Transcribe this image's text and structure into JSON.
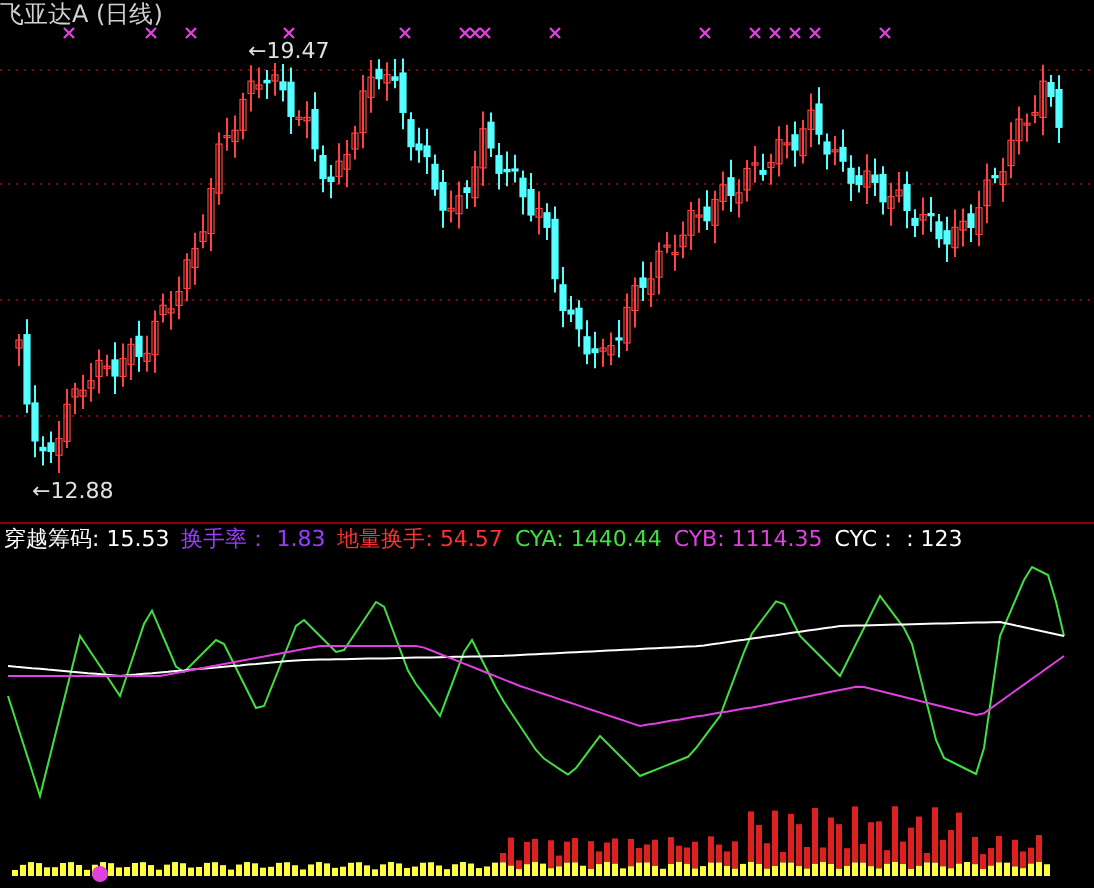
{
  "title": "飞亚达A (日线)",
  "price_chart": {
    "high_label": "←19.47",
    "low_label": "←12.88"
  },
  "indicator": {
    "items": [
      {
        "label": "穿越筹码:",
        "value": "15.53",
        "color": "#ffffff"
      },
      {
        "label": "换手率：",
        "value": "1.83",
        "color": "#9a3cff"
      },
      {
        "label": "地量换手:",
        "value": "54.57",
        "color": "#ff3030"
      },
      {
        "label": "CYA:",
        "value": "1440.44",
        "color": "#40e040"
      },
      {
        "label": "CYB:",
        "value": "1114.35",
        "color": "#e040e0"
      },
      {
        "label": "CYC：",
        "value": ": 123",
        "color": "#ffffff"
      }
    ]
  }
}
